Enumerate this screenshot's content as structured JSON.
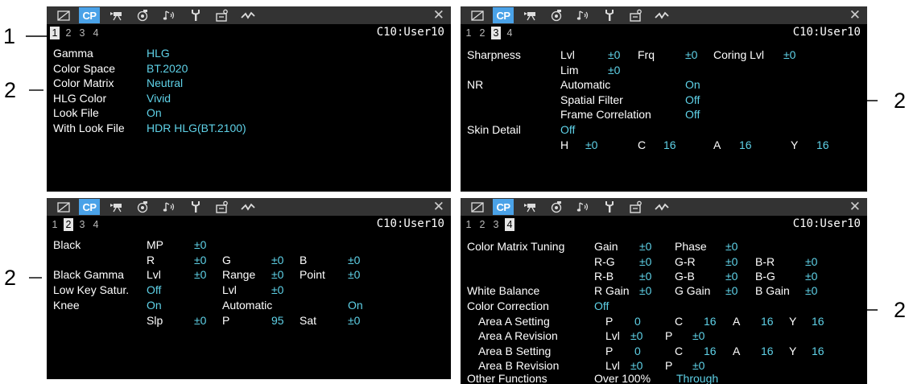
{
  "common": {
    "tab_cp_label": "CP",
    "file_name": "C10:User10",
    "pages": [
      "1",
      "2",
      "3",
      "4"
    ]
  },
  "callouts": {
    "file_name": "1",
    "settings": "2"
  },
  "page1": {
    "gamma_label": "Gamma",
    "gamma_value": "HLG",
    "color_space_label": "Color Space",
    "color_space_value": "BT.2020",
    "color_matrix_label": "Color Matrix",
    "color_matrix_value": "Neutral",
    "hlg_color_label": "HLG Color",
    "hlg_color_value": "Vivid",
    "look_file_label": "Look File",
    "look_file_value": "On",
    "with_look_file_label": "With Look File",
    "with_look_file_value": "HDR HLG(BT.2100)"
  },
  "page2": {
    "black_label": "Black",
    "mp_label": "MP",
    "mp_value": "±0",
    "r_label": "R",
    "r_value": "±0",
    "g_label": "G",
    "g_value": "±0",
    "b_label": "B",
    "b_value": "±0",
    "black_gamma_label": "Black Gamma",
    "bg_lvl_label": "Lvl",
    "bg_lvl_value": "±0",
    "bg_range_label": "Range",
    "bg_range_value": "±0",
    "bg_point_label": "Point",
    "bg_point_value": "±0",
    "low_key_label": "Low Key Satur.",
    "low_key_value": "Off",
    "lk_lvl_label": "Lvl",
    "lk_lvl_value": "±0",
    "knee_label": "Knee",
    "knee_value": "On",
    "knee_auto_label": "Automatic",
    "knee_auto_value": "On",
    "slp_label": "Slp",
    "slp_value": "±0",
    "p_label": "P",
    "p_value": "95",
    "sat_label": "Sat",
    "sat_value": "±0"
  },
  "page3": {
    "sharpness_label": "Sharpness",
    "lvl_label": "Lvl",
    "lvl_value": "±0",
    "frq_label": "Frq",
    "frq_value": "±0",
    "coring_label": "Coring Lvl",
    "coring_value": "±0",
    "lim_label": "Lim",
    "lim_value": "±0",
    "nr_label": "NR",
    "nr_auto_label": "Automatic",
    "nr_auto_value": "On",
    "spatial_label": "Spatial Filter",
    "spatial_value": "Off",
    "frame_corr_label": "Frame Correlation",
    "frame_corr_value": "Off",
    "skin_detail_label": "Skin Detail",
    "skin_detail_value": "Off",
    "h_label": "H",
    "h_value": "±0",
    "c_label": "C",
    "c_value": "16",
    "a_label": "A",
    "a_value": "16",
    "y_label": "Y",
    "y_value": "16"
  },
  "page4": {
    "cmt_label": "Color Matrix Tuning",
    "gain_label": "Gain",
    "gain_value": "±0",
    "phase_label": "Phase",
    "phase_value": "±0",
    "rg_label": "R-G",
    "rg_value": "±0",
    "gr_label": "G-R",
    "gr_value": "±0",
    "br_label": "B-R",
    "br_value": "±0",
    "rb_label": "R-B",
    "rb_value": "±0",
    "gb_label": "G-B",
    "gb_value": "±0",
    "bg_label": "B-G",
    "bg_value": "±0",
    "wb_label": "White Balance",
    "rgain_label": "R Gain",
    "rgain_value": "±0",
    "ggain_label": "G Gain",
    "ggain_value": "±0",
    "bgain_label": "B Gain",
    "bgain_value": "±0",
    "cc_label": "Color Correction",
    "cc_value": "Off",
    "aas_label": "Area A Setting",
    "aas_p_label": "P",
    "aas_p_value": "0",
    "aas_c_label": "C",
    "aas_c_value": "16",
    "aas_a_label": "A",
    "aas_a_value": "16",
    "aas_y_label": "Y",
    "aas_y_value": "16",
    "aar_label": "Area A Revision",
    "aar_lvl_label": "Lvl",
    "aar_lvl_value": "±0",
    "aar_p_label": "P",
    "aar_p_value": "±0",
    "abs_label": "Area B Setting",
    "abs_p_label": "P",
    "abs_p_value": "0",
    "abs_c_label": "C",
    "abs_c_value": "16",
    "abs_a_label": "A",
    "abs_a_value": "16",
    "abs_y_label": "Y",
    "abs_y_value": "16",
    "abr_label": "Area B Revision",
    "abr_lvl_label": "Lvl",
    "abr_lvl_value": "±0",
    "abr_p_label": "P",
    "abr_p_value": "±0",
    "other_label": "Other Functions",
    "other_over_label": "Over 100%",
    "other_over_value": "Through"
  }
}
